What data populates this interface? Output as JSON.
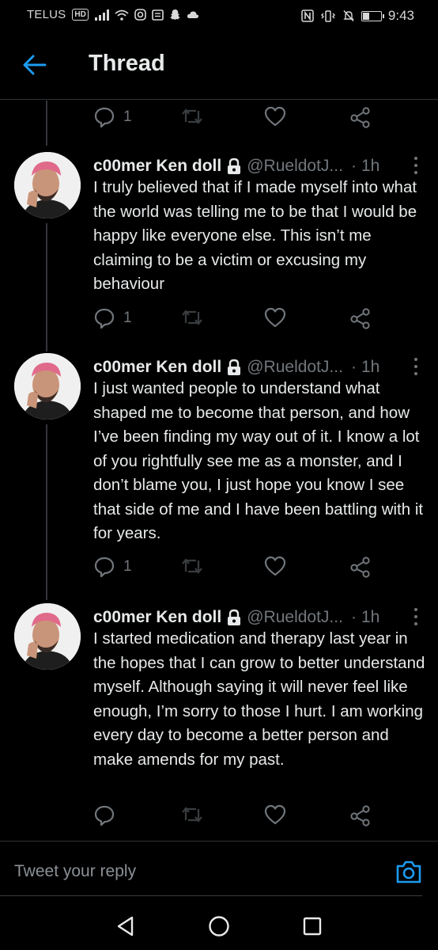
{
  "status_bar": {
    "carrier": "TELUS",
    "hd_badge": "HD",
    "time": "9:43",
    "battery_level": 0.35
  },
  "header": {
    "title": "Thread"
  },
  "top_actions": {
    "reply_count": "1"
  },
  "tweets": [
    {
      "author_name": "c00mer Ken doll",
      "handle": "@RueldotJ...",
      "separator": "·",
      "time": "1h",
      "text": "I truly believed that if I made myself into what the world was telling me to be that I would be happy like everyone else. This isn’t me claiming to be a victim or excusing my behaviour",
      "reply_count": "1"
    },
    {
      "author_name": "c00mer Ken doll",
      "handle": "@RueldotJ...",
      "separator": "·",
      "time": "1h",
      "text": "I just wanted people to understand what shaped me to become that person, and how I’ve been finding my way out of it. I know a lot of you rightfully see me as a monster, and I don’t blame you, I just hope you know I see that side of me and I have been battling with it for years.",
      "reply_count": "1"
    },
    {
      "author_name": "c00mer Ken doll",
      "handle": "@RueldotJ...",
      "separator": "·",
      "time": "1h",
      "text": "I started medication and therapy last year in the hopes that I can grow to better understand myself. Although saying it will never feel like enough, I’m sorry to those I hurt. I am working every day to become a better person and make amends for my past.",
      "reply_count": ""
    }
  ],
  "reply_bar": {
    "placeholder": "Tweet your reply"
  },
  "colors": {
    "accent": "#1d9bf0",
    "background": "#000000",
    "text": "#e7e9ea",
    "muted": "#71767b"
  },
  "icons": {
    "back": "arrow-left-icon",
    "reply": "speech-bubble-icon",
    "retweet": "retweet-icon",
    "like": "heart-icon",
    "share": "share-nodes-icon",
    "lock": "lock-icon",
    "camera": "camera-icon",
    "nav_back": "triangle-back-icon",
    "nav_home": "circle-home-icon",
    "nav_recents": "square-recents-icon"
  }
}
